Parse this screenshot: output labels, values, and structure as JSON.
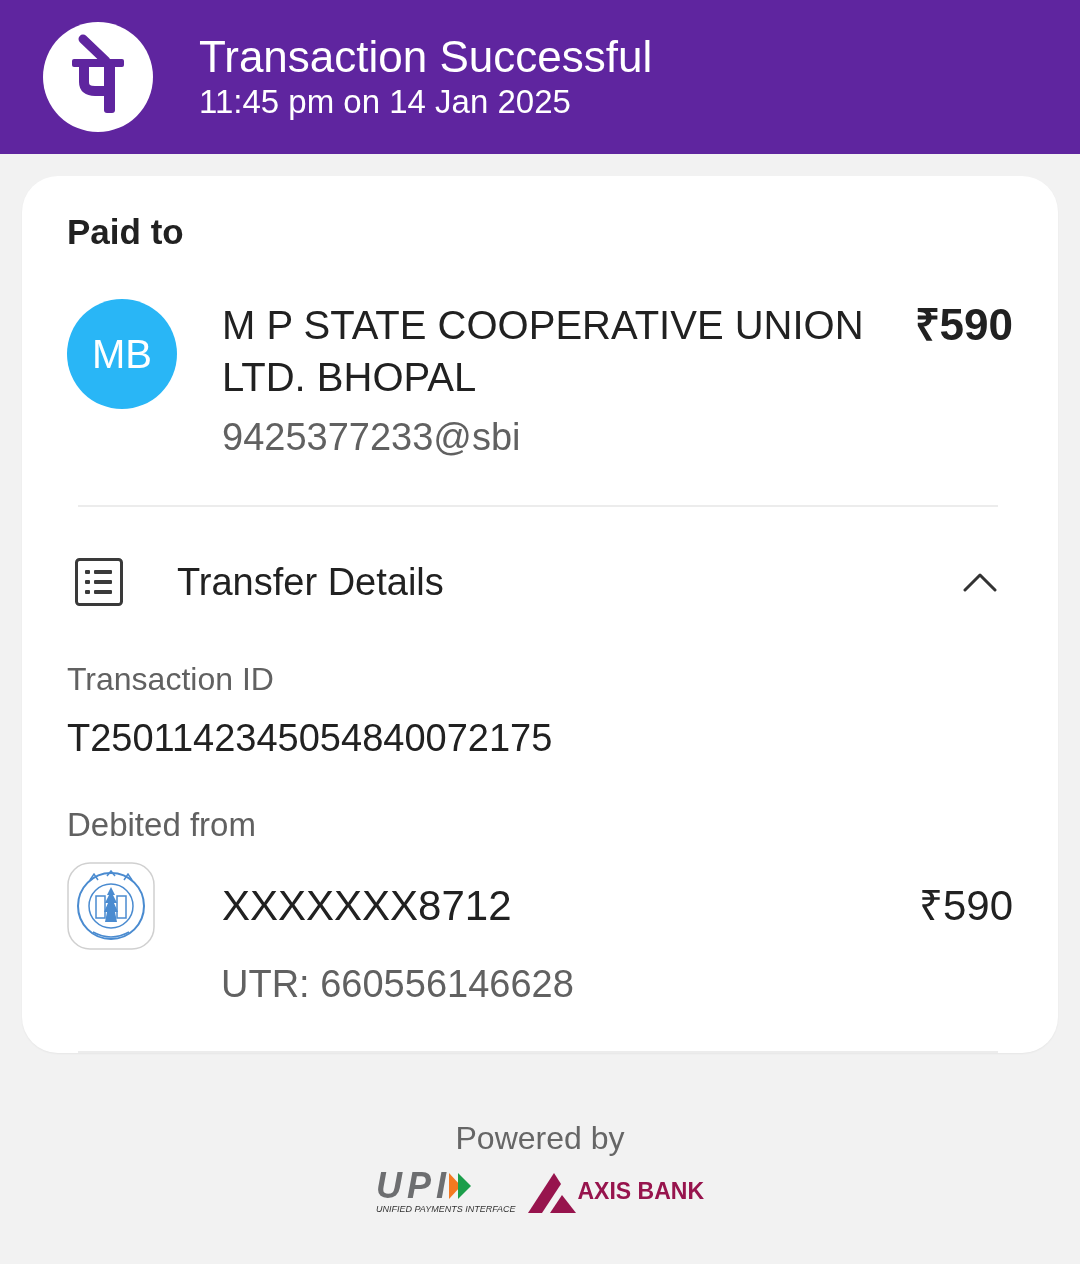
{
  "header": {
    "title": "Transaction Successful",
    "subtitle": "11:45 pm on 14 Jan 2025"
  },
  "paid_to": {
    "heading": "Paid to",
    "avatar_initials": "MB",
    "name": "M P STATE COOPERATIVE UNION LTD. BHOPAL",
    "upi_id": "9425377233@sbi",
    "amount": "₹590"
  },
  "transfer_details": {
    "title": "Transfer Details",
    "expanded": true,
    "transaction_id": {
      "label": "Transaction ID",
      "value": "T2501142345054840072175"
    },
    "debited_from": {
      "label": "Debited from",
      "account": "XXXXXXX8712",
      "amount": "₹590",
      "utr": "UTR: 660556146628"
    }
  },
  "footer": {
    "powered_by": "Powered by",
    "upi_logo": {
      "wordmark": "UPI",
      "tagline": "UNIFIED PAYMENTS INTERFACE"
    },
    "bank_logo": {
      "wordmark": "AXIS BANK"
    }
  }
}
